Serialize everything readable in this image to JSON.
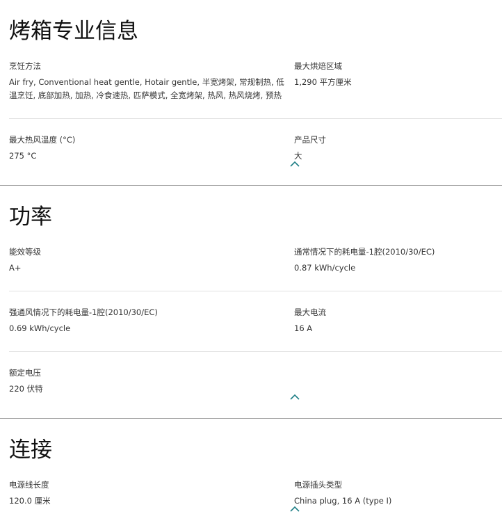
{
  "sections": [
    {
      "title": "烤箱专业信息",
      "rows": [
        [
          {
            "label": "烹饪方法",
            "value": "Air fry, Conventional heat gentle, Hotair gentle, 半宽烤架, 常规制热, 低温烹饪, 底部加热, 加热, 冷食速热, 匹萨模式, 全宽烤架, 热风, 热风烧烤, 预热"
          },
          {
            "label": "最大烘焙区域",
            "value": "1,290 平方厘米"
          }
        ],
        [
          {
            "label": "最大热风温度 (°C)",
            "value": "275 °C"
          },
          {
            "label": "产品尺寸",
            "value": "大"
          }
        ]
      ]
    },
    {
      "title": "功率",
      "rows": [
        [
          {
            "label": "能效等级",
            "value": "A+"
          },
          {
            "label": "通常情况下的耗电量-1腔(2010/30/EC)",
            "value": "0.87 kWh/cycle"
          }
        ],
        [
          {
            "label": "强通风情况下的耗电量-1腔(2010/30/EC)",
            "value": "0.69 kWh/cycle"
          },
          {
            "label": "最大电流",
            "value": "16 A"
          }
        ],
        [
          {
            "label": "额定电压",
            "value": "220 伏特"
          }
        ]
      ]
    },
    {
      "title": "连接",
      "rows": [
        [
          {
            "label": "电源线长度",
            "value": "120.0 厘米"
          },
          {
            "label": "电源插头类型",
            "value": "China plug, 16 A (type I)"
          }
        ]
      ]
    }
  ],
  "colors": {
    "accent": "#1f7f86"
  }
}
